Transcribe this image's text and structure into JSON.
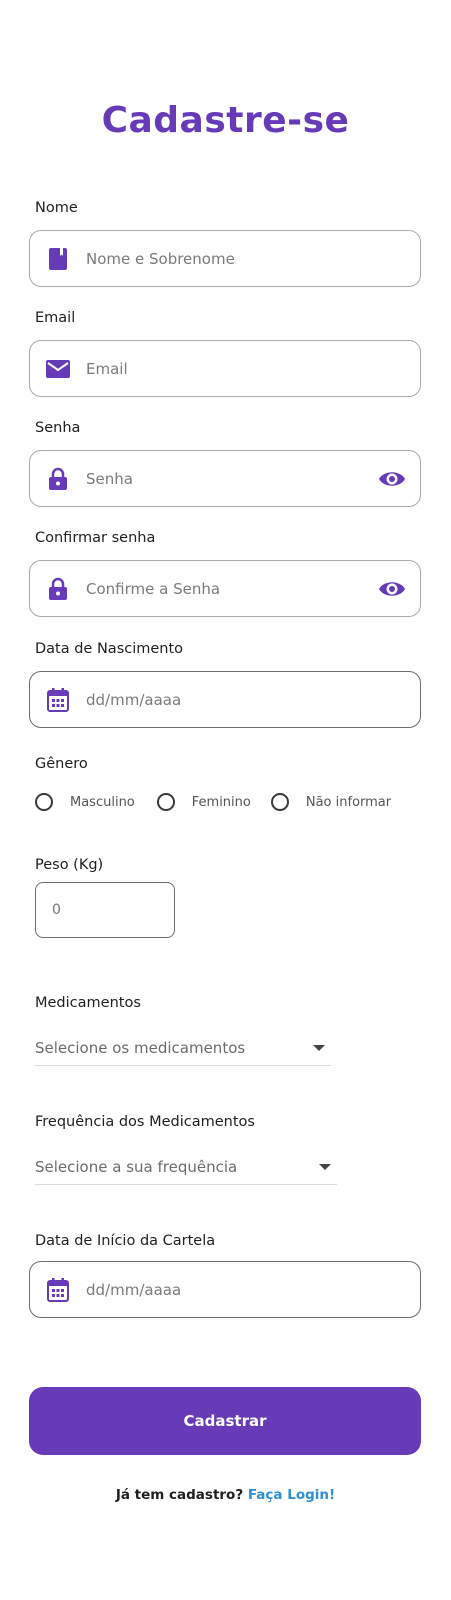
{
  "title": "Cadastre-se",
  "accent_color": "#673ab7",
  "link_color": "#2f8fd6",
  "name": {
    "label": "Nome",
    "placeholder": "Nome e Sobrenome",
    "icon": "contact-book-icon"
  },
  "email": {
    "label": "Email",
    "placeholder": "Email",
    "icon": "mail-icon"
  },
  "password": {
    "label": "Senha",
    "placeholder": "Senha",
    "icon": "lock-icon",
    "toggle_icon": "eye-icon"
  },
  "confirm_password": {
    "label": "Confirmar senha",
    "placeholder": "Confirme a Senha",
    "icon": "lock-icon",
    "toggle_icon": "eye-icon"
  },
  "birth_date": {
    "label": "Data de Nascimento",
    "placeholder": "dd/mm/aaaa",
    "icon": "calendar-icon"
  },
  "gender": {
    "label": "Gênero",
    "options": [
      "Masculino",
      "Feminino",
      "Não informar"
    ]
  },
  "weight": {
    "label": "Peso (Kg)",
    "placeholder": "0"
  },
  "medications": {
    "label": "Medicamentos",
    "placeholder": "Selecione os medicamentos"
  },
  "frequency": {
    "label": "Frequência dos Medicamentos",
    "placeholder": "Selecione a sua frequência"
  },
  "card_start_date": {
    "label": "Data de Início da Cartela",
    "placeholder": "dd/mm/aaaa",
    "icon": "calendar-icon"
  },
  "submit_label": "Cadastrar",
  "footer": {
    "text": "Já tem cadastro?",
    "link": "Faça Login!"
  }
}
